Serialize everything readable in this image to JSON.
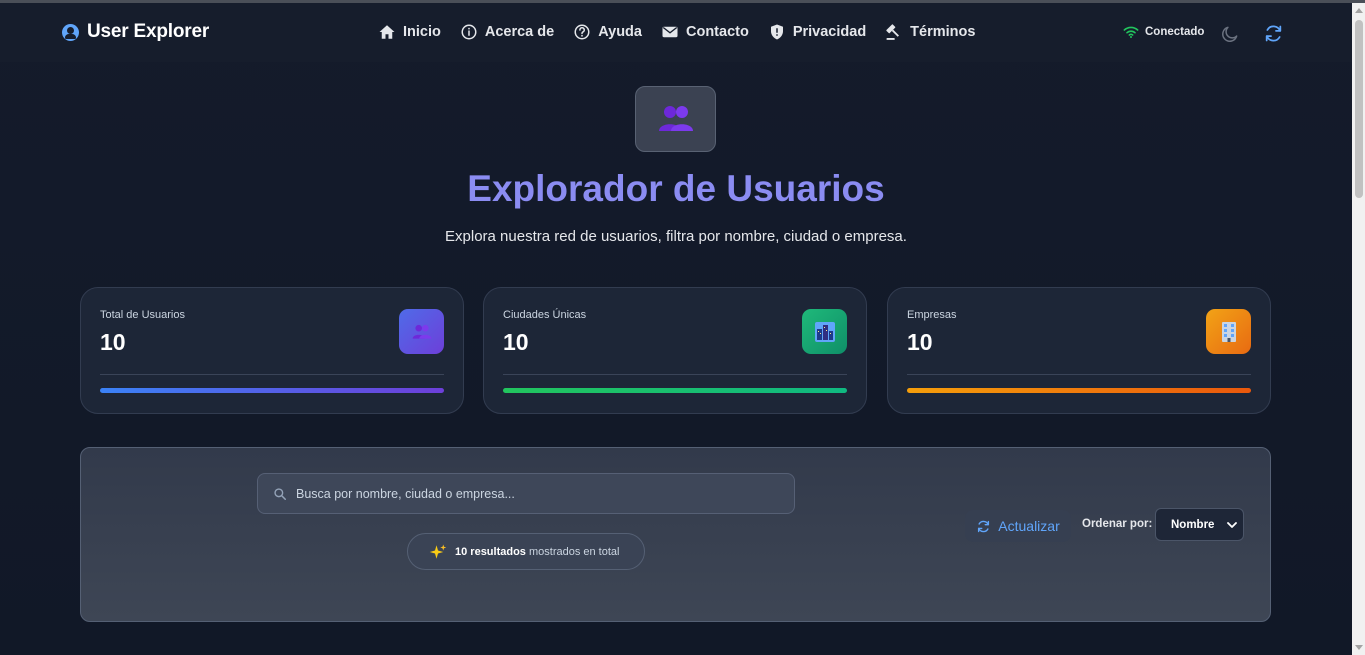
{
  "brand": {
    "title": "User Explorer",
    "icon": "user-circle-icon"
  },
  "nav": [
    {
      "label": "Inicio",
      "icon": "home-icon"
    },
    {
      "label": "Acerca de",
      "icon": "info-icon"
    },
    {
      "label": "Ayuda",
      "icon": "help-icon"
    },
    {
      "label": "Contacto",
      "icon": "mail-icon"
    },
    {
      "label": "Privacidad",
      "icon": "shield-icon"
    },
    {
      "label": "Términos",
      "icon": "gavel-icon"
    }
  ],
  "status": {
    "label": "Conectado",
    "icon": "wifi-icon",
    "color": "#22c55e"
  },
  "hero": {
    "icon": "users-emoji-icon",
    "title": "Explorador de Usuarios",
    "subtitle": "Explora nuestra red de usuarios, filtra por nombre, ciudad o empresa."
  },
  "stats": [
    {
      "label": "Total de Usuarios",
      "value": "10",
      "icon": "users-emoji-icon",
      "color": "#4f46e5"
    },
    {
      "label": "Ciudades Únicas",
      "value": "10",
      "icon": "city-emoji-icon",
      "color": "#10b981"
    },
    {
      "label": "Empresas",
      "value": "10",
      "icon": "office-emoji-icon",
      "color": "#f59e0b"
    }
  ],
  "search": {
    "placeholder": "Busca por nombre, ciudad o empresa...",
    "value": ""
  },
  "results": {
    "count_label": "10 resultados",
    "suffix": "mostrados en total",
    "icon": "sparkles-icon"
  },
  "controls": {
    "update_label": "Actualizar",
    "sort_label": "Ordenar por:",
    "sort_value": "Nombre"
  },
  "colors": {
    "accent": "#60a5fa",
    "title": "#8b8cf2",
    "background": "#111827"
  }
}
